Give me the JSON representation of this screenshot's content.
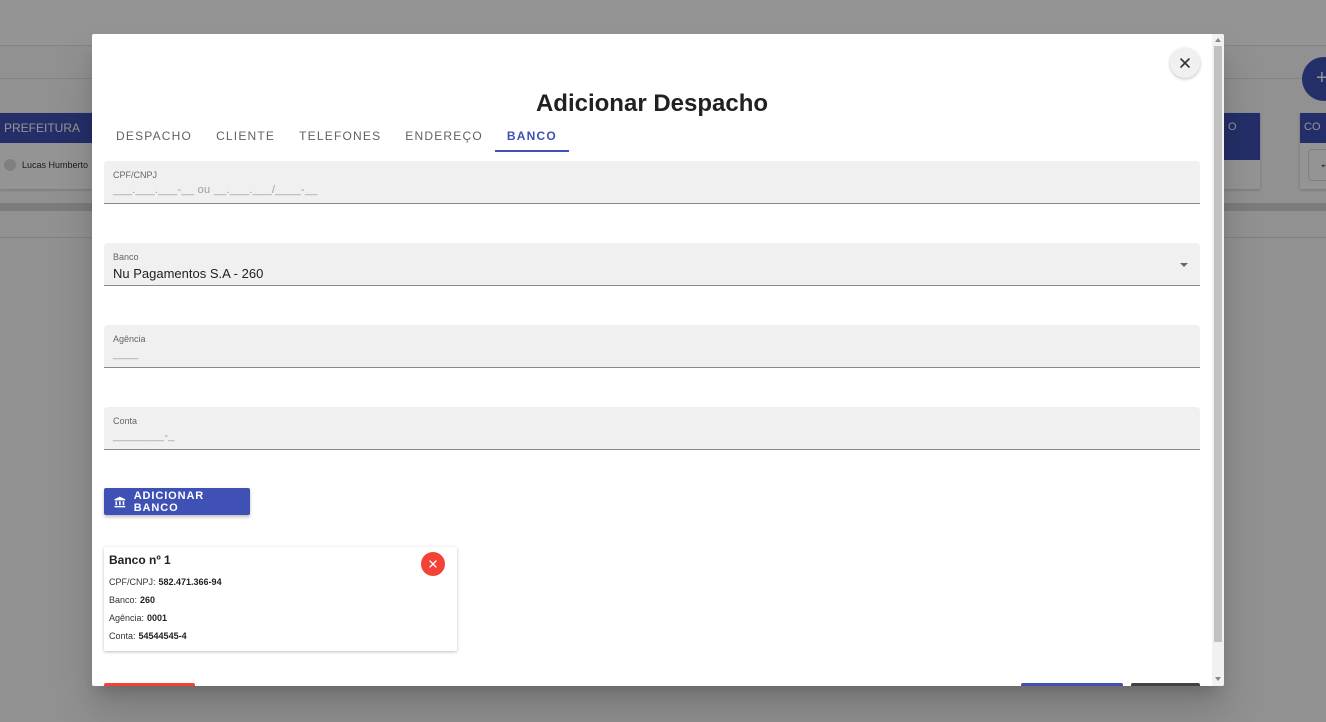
{
  "background": {
    "prefeitura_header": "PREFEITURA",
    "row_name": "Lucas Humberto",
    "right_header_1": "O",
    "right_header_2": "CO",
    "right_arrow": "←",
    "fab_symbol": "+"
  },
  "dialog": {
    "title": "Adicionar Despacho",
    "close_symbol": "×",
    "tabs": [
      "DESPACHO",
      "CLIENTE",
      "TELEFONES",
      "ENDEREÇO",
      "BANCO"
    ],
    "active_tab": "BANCO",
    "fields": {
      "cpf": {
        "label": "CPF/CNPJ",
        "placeholder": "___.___.___-__ ou __.___.___/____-__"
      },
      "banco": {
        "label": "Banco",
        "value": "Nu Pagamentos S.A - 260"
      },
      "agencia": {
        "label": "Agência",
        "placeholder": "____"
      },
      "conta": {
        "label": "Conta",
        "placeholder": "________-_"
      }
    },
    "add_bank_label": "ADICIONAR BANCO",
    "bank_card": {
      "title": "Banco nº 1",
      "cpf_label": "CPF/CNPJ:",
      "cpf_value": "582.471.366-94",
      "banco_label": "Banco:",
      "banco_value": "260",
      "agencia_label": "Agência:",
      "agencia_value": "0001",
      "conta_label": "Conta:",
      "conta_value": "54544545-4"
    }
  },
  "colors": {
    "primary": "#3f51b5",
    "danger": "#f44336",
    "dark": "#424242",
    "field_bg": "#f0f0f0"
  }
}
